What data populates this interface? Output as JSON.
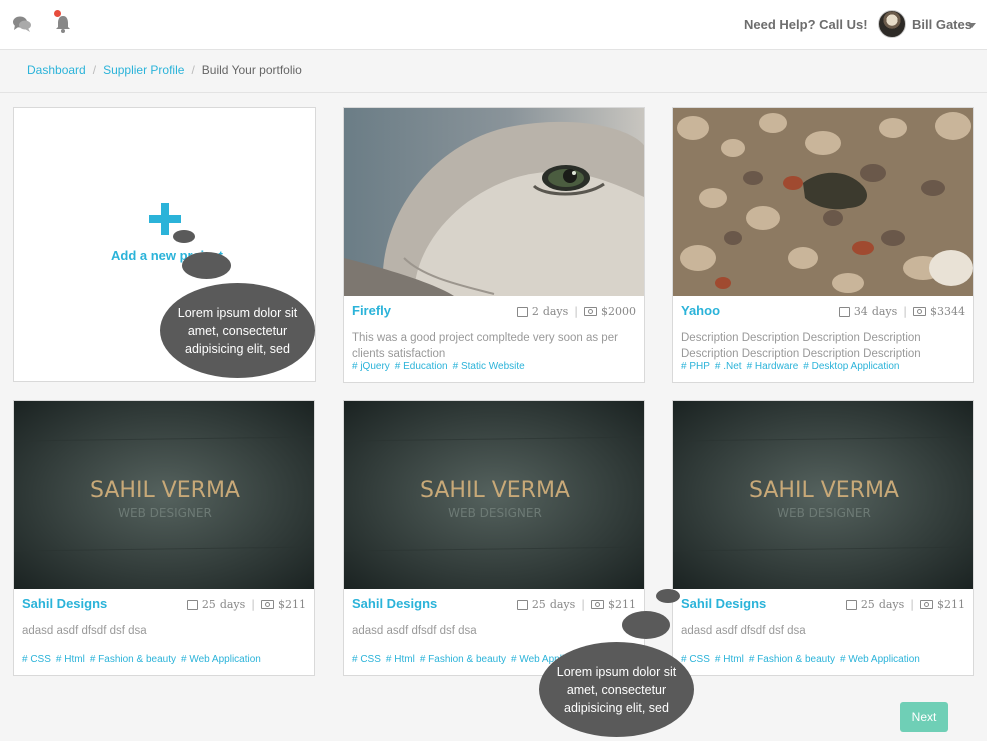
{
  "header": {
    "help_text": "Need Help? Call Us!",
    "user_name": "Bill Gates"
  },
  "breadcrumb": [
    {
      "label": "Dashboard"
    },
    {
      "label": "Supplier Profile"
    },
    {
      "label": "Build Your portfolio"
    }
  ],
  "add_project": {
    "label": "Add a new project"
  },
  "cards": [
    {
      "title": "Firefly",
      "days": "2",
      "days_unit": "days",
      "price": "$2000",
      "description": "This was a good project compltede very soon as per clients satisfaction",
      "tags": [
        "# jQuery",
        "# Education",
        "# Static Website"
      ]
    },
    {
      "title": "Yahoo",
      "days": "34",
      "days_unit": "days",
      "price": "$3344",
      "description": "Description Description Description Description Description Description Description Description",
      "tags": [
        "# PHP",
        "# .Net",
        "# Hardware",
        "# Desktop Application"
      ]
    },
    {
      "title": "Sahil Designs",
      "days": "25",
      "days_unit": "days",
      "price": "$211",
      "description": "adasd asdf dfsdf dsf dsa",
      "tags": [
        "# CSS",
        "# Html",
        "# Fashion & beauty",
        "# Web Application"
      ]
    },
    {
      "title": "Sahil Designs",
      "days": "25",
      "days_unit": "days",
      "price": "$211",
      "description": "adasd asdf dfsdf dsf dsa",
      "tags": [
        "# CSS",
        "# Html",
        "# Fashion & beauty",
        "# Web Application"
      ]
    },
    {
      "title": "Sahil Designs",
      "days": "25",
      "days_unit": "days",
      "price": "$211",
      "description": "adasd asdf dfsdf dsf dsa",
      "tags": [
        "# CSS",
        "# Html",
        "# Fashion & beauty",
        "# Web Application"
      ]
    }
  ],
  "banner": {
    "name": "SAHIL VERMA",
    "role": "WEB DESIGNER"
  },
  "tooltips": [
    {
      "text": "Lorem ipsum dolor sit amet, consectetur adipisicing elit, sed"
    },
    {
      "text": "Lorem ipsum dolor sit amet, consectetur adipisicing elit, sed"
    }
  ],
  "pagination": {
    "next_label": "Next"
  },
  "colors": {
    "accent": "#2bb3d9",
    "next_button": "#6fcfb6",
    "bubble": "#5a5a5a",
    "notification": "#e74c3c"
  }
}
